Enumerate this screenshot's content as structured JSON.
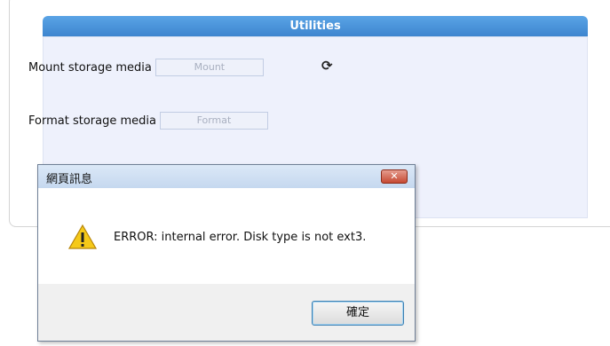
{
  "panel": {
    "title": "Utilities",
    "mount": {
      "label": "Mount storage media",
      "button": "Mount"
    },
    "format": {
      "label": "Format storage media",
      "button": "Format"
    },
    "refresh_icon": "refresh-icon"
  },
  "dialog": {
    "title": "網頁訊息",
    "close_label": "✕",
    "message": "ERROR: internal error. Disk type is not ext3.",
    "ok_label": "確定",
    "icon": "warning-icon"
  }
}
